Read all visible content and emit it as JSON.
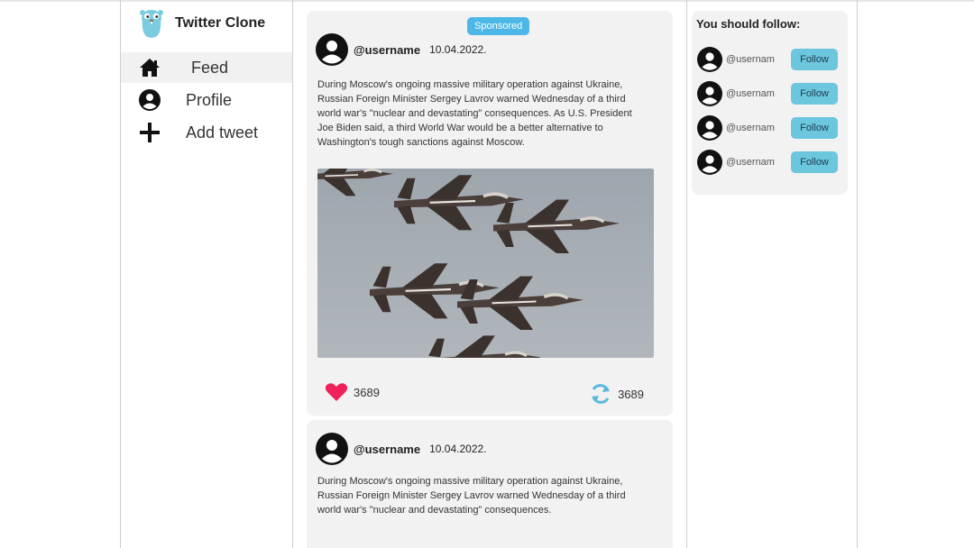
{
  "app": {
    "title": "Twitter Clone"
  },
  "nav": {
    "items": [
      {
        "label": "Feed",
        "icon": "home-icon",
        "active": true
      },
      {
        "label": "Profile",
        "icon": "user-icon",
        "active": false
      },
      {
        "label": "Add tweet",
        "icon": "plus-icon",
        "active": false
      }
    ]
  },
  "feed": {
    "posts": [
      {
        "badge": "Sponsored",
        "username": "@username",
        "date": "10.04.2022.",
        "text": "During Moscow's ongoing massive military operation against Ukraine, Russian Foreign Minister Sergey Lavrov warned Wednesday of a third world war's \"nuclear and devastating\" consequences. As U.S. President Joe Biden said, a third World War would be a better alternative to Washington's tough sanctions against Moscow.",
        "image": "fighter-jets-photo",
        "likes": "3689",
        "retweets": "3689"
      },
      {
        "username": "@username",
        "date": "10.04.2022.",
        "text": "During Moscow's ongoing massive military operation against Ukraine, Russian Foreign Minister Sergey Lavrov warned Wednesday of a third world war's \"nuclear and devastating\" consequences."
      }
    ]
  },
  "suggestions": {
    "title": "You should follow:",
    "items": [
      {
        "name": "@usernam",
        "button": "Follow"
      },
      {
        "name": "@usernam",
        "button": "Follow"
      },
      {
        "name": "@usernam",
        "button": "Follow"
      },
      {
        "name": "@usernam",
        "button": "Follow"
      }
    ]
  },
  "colors": {
    "accent": "#4db8e8",
    "follow_button": "#6cc6dd",
    "like": "#f0205a",
    "retweet": "#5ab8de",
    "card_bg": "#f2f2f2"
  }
}
